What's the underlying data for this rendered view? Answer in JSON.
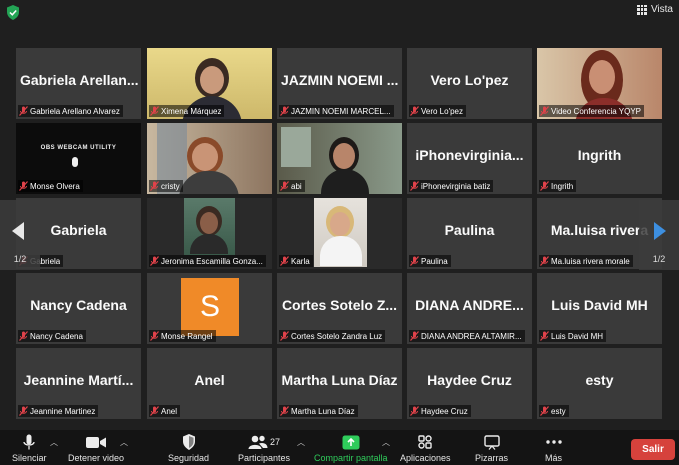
{
  "top": {
    "view_label": "Vista"
  },
  "colors": {
    "speaker_border": "#e3d36a",
    "share_green": "#2fcc5b",
    "leave_red": "#d6423c",
    "mic_off_red": "#e0424a"
  },
  "pager": {
    "left": "1/2",
    "right": "1/2"
  },
  "tiles": [
    {
      "big": "Gabriela  Arellan...",
      "label": "Gabriela Arellano Alvarez"
    },
    {
      "big": "",
      "label": "Ximena Márquez",
      "video": "woman-glasses"
    },
    {
      "big": "JAZMIN  NOEMI ...",
      "label": "JAZMIN NOEMI MARCEL..."
    },
    {
      "big": "Vero Lo'pez",
      "label": "Vero Lo'pez"
    },
    {
      "big": "",
      "label": "Video Conferencia YQYP",
      "video": "speaker",
      "speaking": true
    },
    {
      "big": "",
      "label": "Monse Olvera",
      "video": "obs",
      "overlay": "OBS WEBCAM UTILITY"
    },
    {
      "big": "",
      "label": "cristy",
      "video": "woman-room"
    },
    {
      "big": "",
      "label": "abi",
      "video": "woman-window"
    },
    {
      "big": "iPhonevirginia...",
      "label": "iPhonevirginia batiz"
    },
    {
      "big": "Ingrith",
      "label": "Ingrith"
    },
    {
      "big": "Gabriela",
      "label": "Gabriela"
    },
    {
      "big": "",
      "label": "Jeronima Escamilla Gonza...",
      "video": "woman-small"
    },
    {
      "big": "",
      "label": "Karla",
      "video": "woman-blonde"
    },
    {
      "big": "Paulina",
      "label": "Paulina"
    },
    {
      "big": "Ma.luisa  rivera",
      "label": "Ma.luisa rivera morale"
    },
    {
      "big": "Nancy Cadena",
      "label": "Nancy Cadena"
    },
    {
      "big": "",
      "label": "Monse Rangel",
      "avatar_letter": "S"
    },
    {
      "big": "Cortes Sotelo  Z...",
      "label": "Cortes Sotelo Zandra Luz"
    },
    {
      "big": "DIANA  ANDRE...",
      "label": "DIANA ANDREA ALTAMIR..."
    },
    {
      "big": "Luis David MH",
      "label": "Luis David MH"
    },
    {
      "big": "Jeannine  Martí...",
      "label": "Jeannine Martinez"
    },
    {
      "big": "Anel",
      "label": "Anel"
    },
    {
      "big": "Martha Luna Díaz",
      "label": "Martha Luna Díaz"
    },
    {
      "big": "Haydee Cruz",
      "label": "Haydee Cruz"
    },
    {
      "big": "esty",
      "label": "esty"
    }
  ],
  "toolbar": {
    "mute": "Silenciar",
    "video": "Detener video",
    "security": "Seguridad",
    "participants": "Participantes",
    "participants_count": "27",
    "share": "Compartir pantalla",
    "apps": "Aplicaciones",
    "whiteboard": "Pizarras",
    "more": "Más",
    "leave": "Salir"
  }
}
